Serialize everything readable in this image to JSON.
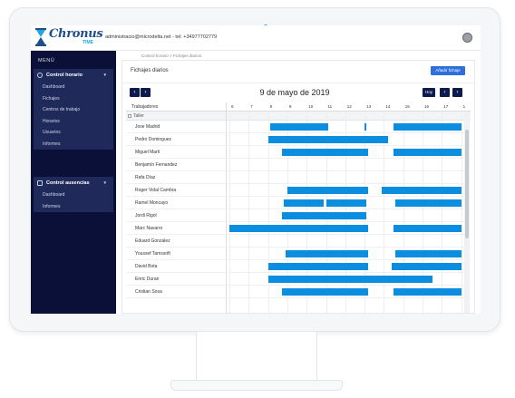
{
  "header": {
    "logo_text": "Chronus",
    "logo_sub": "TIME",
    "contact": "administracio@microdelta.net - tel: +34977702779"
  },
  "sidebar": {
    "menu_title": "MENÚ",
    "groups": [
      {
        "label": "Control horario",
        "items": [
          "Dashboard",
          "Fichajes",
          "Centros de trabajo",
          "Horarios",
          "Usuarios",
          "Informes"
        ]
      },
      {
        "label": "Control ausencias",
        "items": [
          "Dashboard",
          "Informes"
        ]
      }
    ]
  },
  "breadcrumb": "Control horario  >  Fichajes diarios",
  "page": {
    "title": "Fichajes diarios",
    "add_button": "Añadir fichaje",
    "date": "9 de mayo de 2019",
    "today_button": "Hoy",
    "prev_icon": "‹",
    "next_icon": "›"
  },
  "gantt": {
    "column_label": "Trabajadores",
    "hours": [
      "6",
      "7",
      "8",
      "9",
      "10",
      "11",
      "12",
      "13",
      "14",
      "15",
      "16",
      "17",
      "1"
    ],
    "group": "Taller",
    "workers": [
      {
        "name": "Jose Madrid",
        "shifts": [
          [
            8.1,
            11.1
          ],
          [
            13.0,
            13.1
          ],
          [
            14.5,
            18
          ]
        ]
      },
      {
        "name": "Pedro Dominguez",
        "shifts": [
          [
            8.0,
            14.2
          ]
        ]
      },
      {
        "name": "Miguel Martí",
        "shifts": [
          [
            8.7,
            13.2
          ],
          [
            14.5,
            18
          ]
        ]
      },
      {
        "name": "Benjamín Fernandez",
        "shifts": []
      },
      {
        "name": "Rafa Díaz",
        "shifts": []
      },
      {
        "name": "Roger Vidal Cambra",
        "shifts": [
          [
            9.0,
            13.2
          ],
          [
            13.9,
            18
          ]
        ]
      },
      {
        "name": "Ramel Moncayo",
        "shifts": [
          [
            8.8,
            10.9
          ],
          [
            11.0,
            13.1
          ],
          [
            14.6,
            18
          ]
        ]
      },
      {
        "name": "Jordi Rigol",
        "shifts": [
          [
            8.7,
            13.1
          ]
        ]
      },
      {
        "name": "Marc Navarro",
        "shifts": [
          [
            6.0,
            8.4
          ],
          [
            8.4,
            13.2
          ],
          [
            14.5,
            18
          ]
        ]
      },
      {
        "name": "Eduard Gonzalez",
        "shifts": []
      },
      {
        "name": "Youssef Tamssrift",
        "shifts": [
          [
            8.9,
            13.2
          ],
          [
            14.6,
            18
          ]
        ]
      },
      {
        "name": "David Bota",
        "shifts": [
          [
            8.0,
            13.2
          ],
          [
            14.4,
            18
          ]
        ]
      },
      {
        "name": "Enric Duran",
        "shifts": [
          [
            8.0,
            16.5
          ]
        ]
      },
      {
        "name": "Cristian Sosa",
        "shifts": [
          [
            8.7,
            13.2
          ],
          [
            14.5,
            18
          ]
        ]
      }
    ]
  },
  "colors": {
    "sidebar_bg": "#0b1038",
    "bar": "#0b8de0",
    "accent": "#2f6fdc"
  }
}
